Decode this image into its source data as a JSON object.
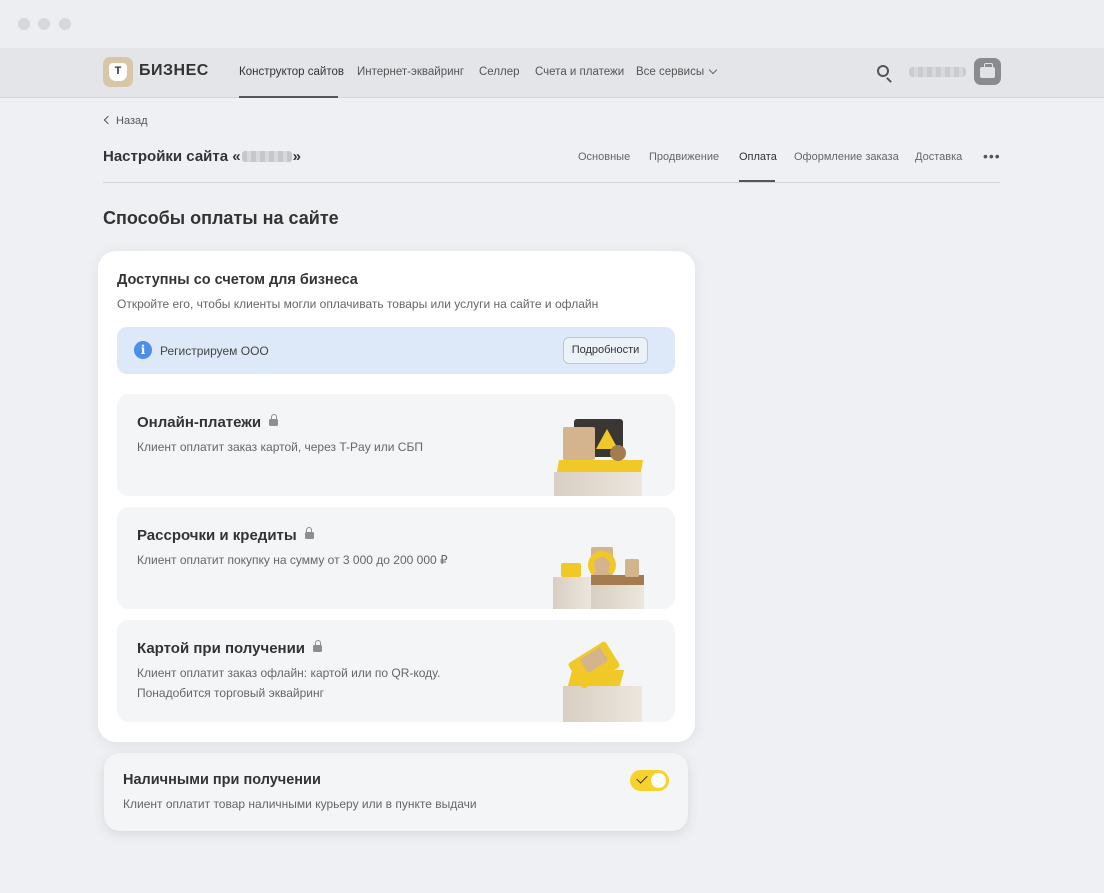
{
  "header": {
    "logo_letter": "Т",
    "brand": "БИЗНЕС",
    "nav": [
      {
        "label": "Конструктор сайтов"
      },
      {
        "label": "Интернет-эквайринг"
      },
      {
        "label": "Селлер"
      },
      {
        "label": "Счета и платежи"
      },
      {
        "label": "Все сервисы"
      }
    ]
  },
  "subheader": {
    "back_label": "Назад",
    "title_prefix": "Настройки сайта «",
    "title_suffix": "»",
    "tabs": [
      {
        "label": "Основные"
      },
      {
        "label": "Продвижение"
      },
      {
        "label": "Оплата"
      },
      {
        "label": "Оформление заказа"
      },
      {
        "label": "Доставка"
      }
    ],
    "more_label": "•••",
    "active_tab": "Оплата"
  },
  "section_title": "Способы оплаты на сайте",
  "business_card": {
    "title": "Доступны со счетом для бизнеса",
    "subtitle": "Откройте его, чтобы клиенты могли оплачивать товары или услуги на сайте и офлайн",
    "banner": {
      "icon_glyph": "i",
      "text": "Регистрируем ООО",
      "button_label": "Подробности"
    },
    "methods": [
      {
        "title": "Онлайн-платежи",
        "desc": [
          "Клиент оплатит заказ картой, через T-Pay или СБП"
        ]
      },
      {
        "title": "Рассрочки и кредиты",
        "desc": [
          "Клиент оплатит покупку на сумму от 3 000 до 200 000 ₽"
        ]
      },
      {
        "title": "Картой при получении",
        "desc": [
          "Клиент оплатит заказ офлайн: картой или по QR-коду.",
          "Понадобится торговый эквайринг"
        ]
      }
    ]
  },
  "cash_card": {
    "title": "Наличными при получении",
    "desc": "Клиент оплатит товар наличными курьеру или в пункте выдачи",
    "enabled": true
  },
  "colors": {
    "accent_yellow": "#f8d22c",
    "info_blue": "#4f8ee6",
    "banner_bg": "#dde9f8"
  }
}
